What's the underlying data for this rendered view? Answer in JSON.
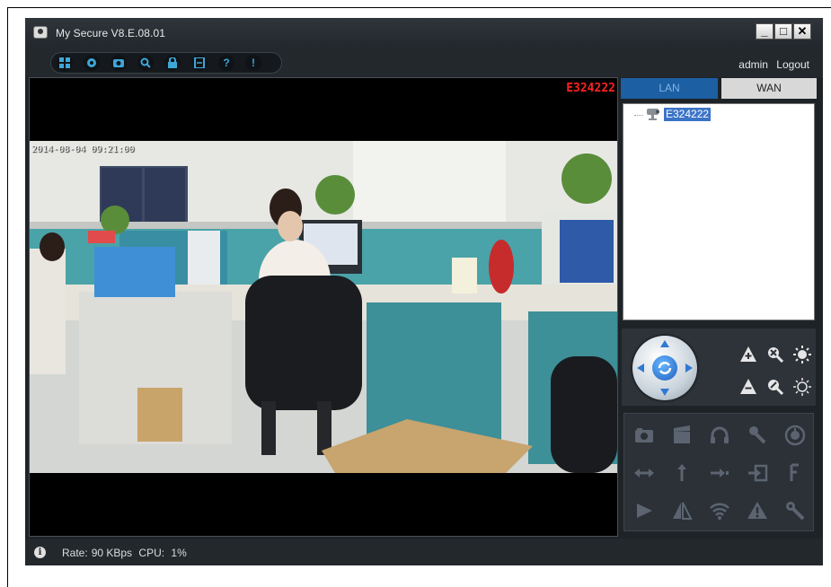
{
  "window": {
    "title": "My Secure  V8.E.08.01",
    "minimize_label": "_",
    "maximize_label": "□",
    "close_label": "✕"
  },
  "toolbar": {
    "icons": [
      "grid-view-icon",
      "settings-icon",
      "snapshot-icon",
      "search-icon",
      "lock-icon",
      "record-file-icon",
      "help-icon",
      "info-icon"
    ]
  },
  "user": {
    "name": "admin",
    "logout_label": "Logout"
  },
  "video": {
    "camera_overlay": "E324222",
    "timestamp": "2014-08-04 09:21:00"
  },
  "tabs": {
    "lan_label": "LAN",
    "wan_label": "WAN",
    "active": "LAN"
  },
  "device_tree": {
    "devices": [
      {
        "name": "E324222",
        "icon": "camera-icon",
        "selected": true
      }
    ]
  },
  "ptz": {
    "controls": [
      "pan-tilt-joystick",
      "zoom-in",
      "zoom-out",
      "focus-near",
      "focus-far",
      "iris-open",
      "iris-close"
    ]
  },
  "function_icons": [
    [
      "snapshot-icon",
      "record-icon",
      "audio-icon",
      "talk-icon",
      "timer-icon"
    ],
    [
      "horizontal-scan-icon",
      "vertical-scan-icon",
      "move-icon",
      "input-icon",
      "flip-icon"
    ],
    [
      "play-icon",
      "mirror-icon",
      "wifi-icon",
      "alarm-icon",
      "tools-icon"
    ]
  ],
  "status": {
    "rate_label": "Rate:",
    "rate_value": "90 KBps",
    "cpu_label": "CPU:",
    "cpu_value": "1%"
  },
  "colors": {
    "accent": "#1c5fa3",
    "overlay_red": "#ff2020",
    "toolbar_icon": "#3ea6d8",
    "background": "#1e2328"
  }
}
